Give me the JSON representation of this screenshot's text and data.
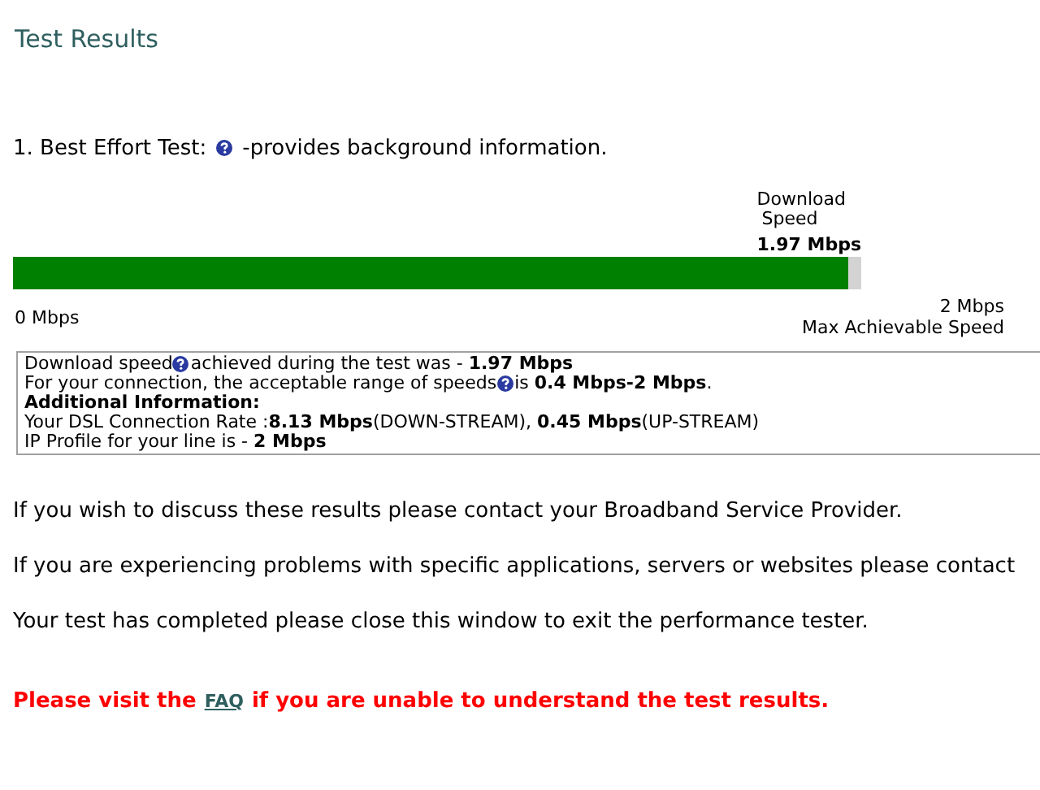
{
  "title": "Test Results",
  "test": {
    "label": "1. Best Effort Test:",
    "note": "-provides background information."
  },
  "meter": {
    "caption_lines": [
      "Download",
      "Speed"
    ],
    "reading": "1.97 Mbps",
    "level": 0.985,
    "min_label": "0 Mbps",
    "max_label": "2 Mbps",
    "max_caption": "Max Achievable Speed"
  },
  "info_lines": [
    [
      {
        "kind": "text",
        "text": "Download speed"
      },
      {
        "kind": "help"
      },
      {
        "kind": "text",
        "text": "achieved during the test was - **1.97 Mbps**"
      }
    ],
    [
      {
        "kind": "text",
        "text": "For your connection, the acceptable range of speeds"
      },
      {
        "kind": "help"
      },
      {
        "kind": "text",
        "text": "is **0.4 Mbps-2 Mbps**."
      }
    ],
    [
      {
        "kind": "heading",
        "text": "Additional Information:"
      }
    ],
    [
      {
        "kind": "text",
        "text": "Your DSL Connection Rate :**8.13 Mbps**(DOWN-STREAM), **0.45 Mbps**(UP-STREAM)"
      }
    ],
    [
      {
        "kind": "text",
        "text": "IP Profile for your line is - **2 Mbps**"
      }
    ]
  ],
  "messages": [
    "If you wish to discuss these results please contact your Broadband Service Provider.",
    "If you are experiencing problems with specific applications, servers or websites please contact",
    "Your test has completed please close this window to exit the performance tester."
  ],
  "notice": {
    "before": "Please visit the",
    "link": "FAQ",
    "after": "if you are unable to understand the test results."
  }
}
